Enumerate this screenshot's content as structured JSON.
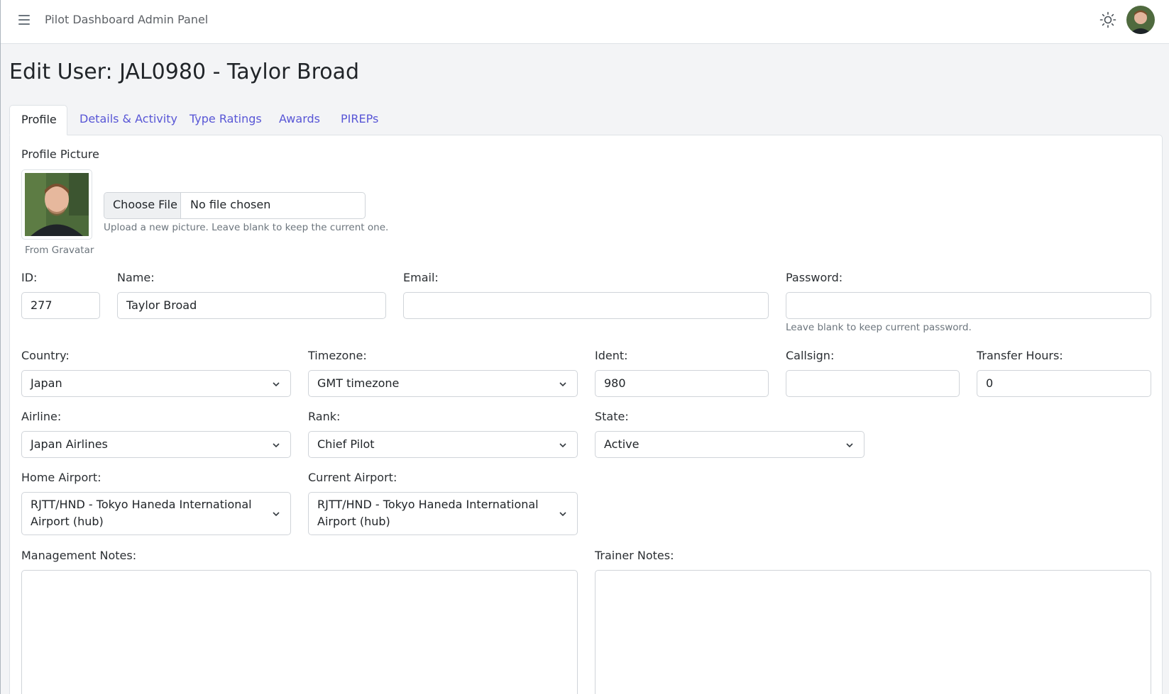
{
  "nav": {
    "menu_icon": "hamburger-menu-icon",
    "links": [
      "Pilot Dashboard",
      "Admin Panel"
    ],
    "theme_icon": "sun-icon",
    "avatar": "user-avatar"
  },
  "page": {
    "title": "Edit User: JAL0980 - Taylor Broad"
  },
  "tabs": [
    "Profile",
    "Details & Activity",
    "Type Ratings",
    "Awards",
    "PIREPs"
  ],
  "profile_picture": {
    "label": "Profile Picture",
    "caption": "From Gravatar",
    "choose_file": "Choose File",
    "file_status": "No file chosen",
    "help": "Upload a new picture. Leave blank to keep the current one."
  },
  "fields": {
    "id": {
      "label": "ID:",
      "value": "277"
    },
    "name": {
      "label": "Name:",
      "value": "Taylor Broad"
    },
    "email": {
      "label": "Email:",
      "value": ""
    },
    "password": {
      "label": "Password:",
      "value": "",
      "help": "Leave blank to keep current password."
    },
    "country": {
      "label": "Country:",
      "value": "Japan"
    },
    "timezone": {
      "label": "Timezone:",
      "value": "GMT timezone"
    },
    "ident": {
      "label": "Ident:",
      "value": "980"
    },
    "callsign": {
      "label": "Callsign:",
      "value": ""
    },
    "transfer_hours": {
      "label": "Transfer Hours:",
      "value": "0"
    },
    "airline": {
      "label": "Airline:",
      "value": "Japan Airlines"
    },
    "rank": {
      "label": "Rank:",
      "value": "Chief Pilot"
    },
    "state": {
      "label": "State:",
      "value": "Active"
    },
    "home_airport": {
      "label": "Home Airport:",
      "value": "RJTT/HND - Tokyo Haneda International Airport (hub)"
    },
    "current_airport": {
      "label": "Current Airport:",
      "value": "RJTT/HND - Tokyo Haneda International Airport (hub)"
    },
    "management_notes": {
      "label": "Management Notes:",
      "value": ""
    },
    "trainer_notes": {
      "label": "Trainer Notes:",
      "value": ""
    }
  },
  "colors": {
    "accent": "#5856d6",
    "background": "#f3f4f6"
  }
}
